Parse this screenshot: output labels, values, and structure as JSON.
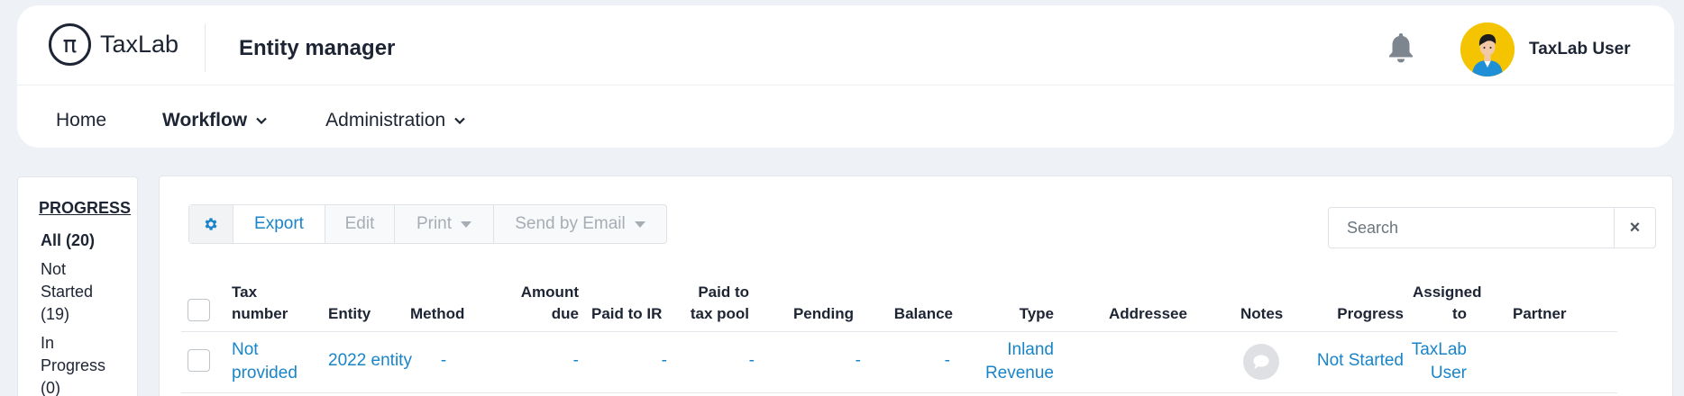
{
  "app": {
    "logo_text": "TaxLab",
    "page_title": "Entity manager",
    "user_name": "TaxLab User"
  },
  "nav": {
    "home": "Home",
    "workflow": "Workflow",
    "administration": "Administration"
  },
  "progress_filter": {
    "heading": "PROGRESS",
    "items": [
      {
        "label": "All (20)"
      },
      {
        "label": "Not Started (19)"
      },
      {
        "label": "In Progress (0)"
      }
    ]
  },
  "toolbar": {
    "export": "Export",
    "edit": "Edit",
    "print": "Print",
    "send_email": "Send by Email"
  },
  "search": {
    "placeholder": "Search",
    "clear": "×"
  },
  "table": {
    "headers": {
      "tax_number": "Tax number",
      "entity": "Entity",
      "method": "Method",
      "amount_due": "Amount due",
      "paid_to_ir": "Paid to IR",
      "paid_to_tax_pool": "Paid to tax pool",
      "pending": "Pending",
      "balance": "Balance",
      "type": "Type",
      "addressee": "Addressee",
      "notes": "Notes",
      "progress": "Progress",
      "assigned_to": "Assigned to",
      "partner": "Partner"
    },
    "rows": [
      {
        "tax_number": "Not provided",
        "entity": "2022 entity",
        "method": "-",
        "amount_due": "-",
        "paid_to_ir": "-",
        "paid_to_tax_pool": "-",
        "pending": "-",
        "balance": "-",
        "type": "Inland Revenue",
        "addressee": "",
        "progress": "Not Started",
        "assigned_to": "TaxLab User",
        "partner": ""
      }
    ]
  },
  "colors": {
    "accent": "#1a84c8",
    "text": "#1d2433",
    "avatar_bg": "#f5c400",
    "page_bg": "#eef1f5"
  },
  "icons": [
    "pi-logo-icon",
    "bell-icon",
    "user-avatar",
    "chevron-down-icon",
    "gear-icon",
    "caret-down-icon",
    "close-icon",
    "comment-icon"
  ]
}
